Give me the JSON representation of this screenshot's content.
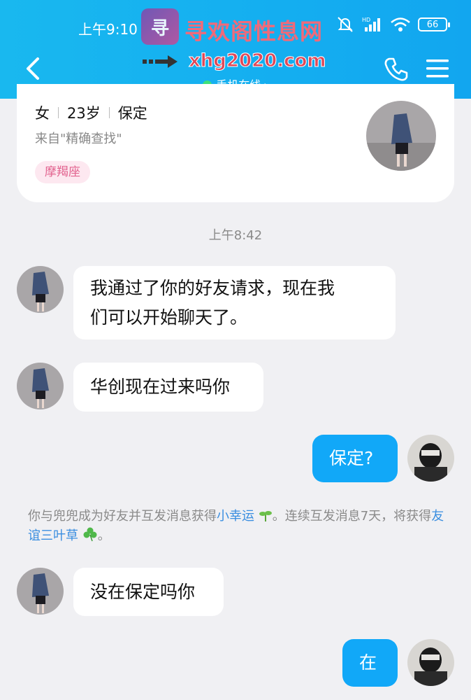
{
  "status_bar": {
    "time": "上午9:10",
    "battery": "66"
  },
  "header": {
    "presence": "手机在线"
  },
  "watermark": {
    "title": "寻欢阁性息网",
    "url": "xhg2020.com"
  },
  "profile": {
    "gender": "女",
    "age": "23岁",
    "city": "保定",
    "source": "来自\"精确查找\"",
    "zodiac": "摩羯座"
  },
  "timestamp": "上午8:42",
  "messages": [
    {
      "side": "in",
      "lines": [
        "我通过了你的好友请求，现在我",
        "们可以开始聊天了。"
      ]
    },
    {
      "side": "in",
      "text": "华创现在过来吗你"
    },
    {
      "side": "out",
      "text": "保定?"
    },
    {
      "side": "in",
      "text": "没在保定吗你"
    },
    {
      "side": "out",
      "text": "在"
    }
  ],
  "system_note": {
    "part1": "你与兜兜成为好友并互发消息获得",
    "link1": "小幸运",
    "part2": "。连续互发消息7天，将获得",
    "link2": "友谊三叶草",
    "part3": "。"
  },
  "icons": {
    "back": "chevron-left-icon",
    "phone": "phone-icon",
    "menu": "menu-icon",
    "sprout": "sprout-icon",
    "clover": "clover-icon"
  },
  "colors": {
    "header": "#14aef0",
    "bubble_out": "#11a8f8",
    "online_dot": "#3fe07a",
    "zodiac_text": "#e2638f"
  }
}
